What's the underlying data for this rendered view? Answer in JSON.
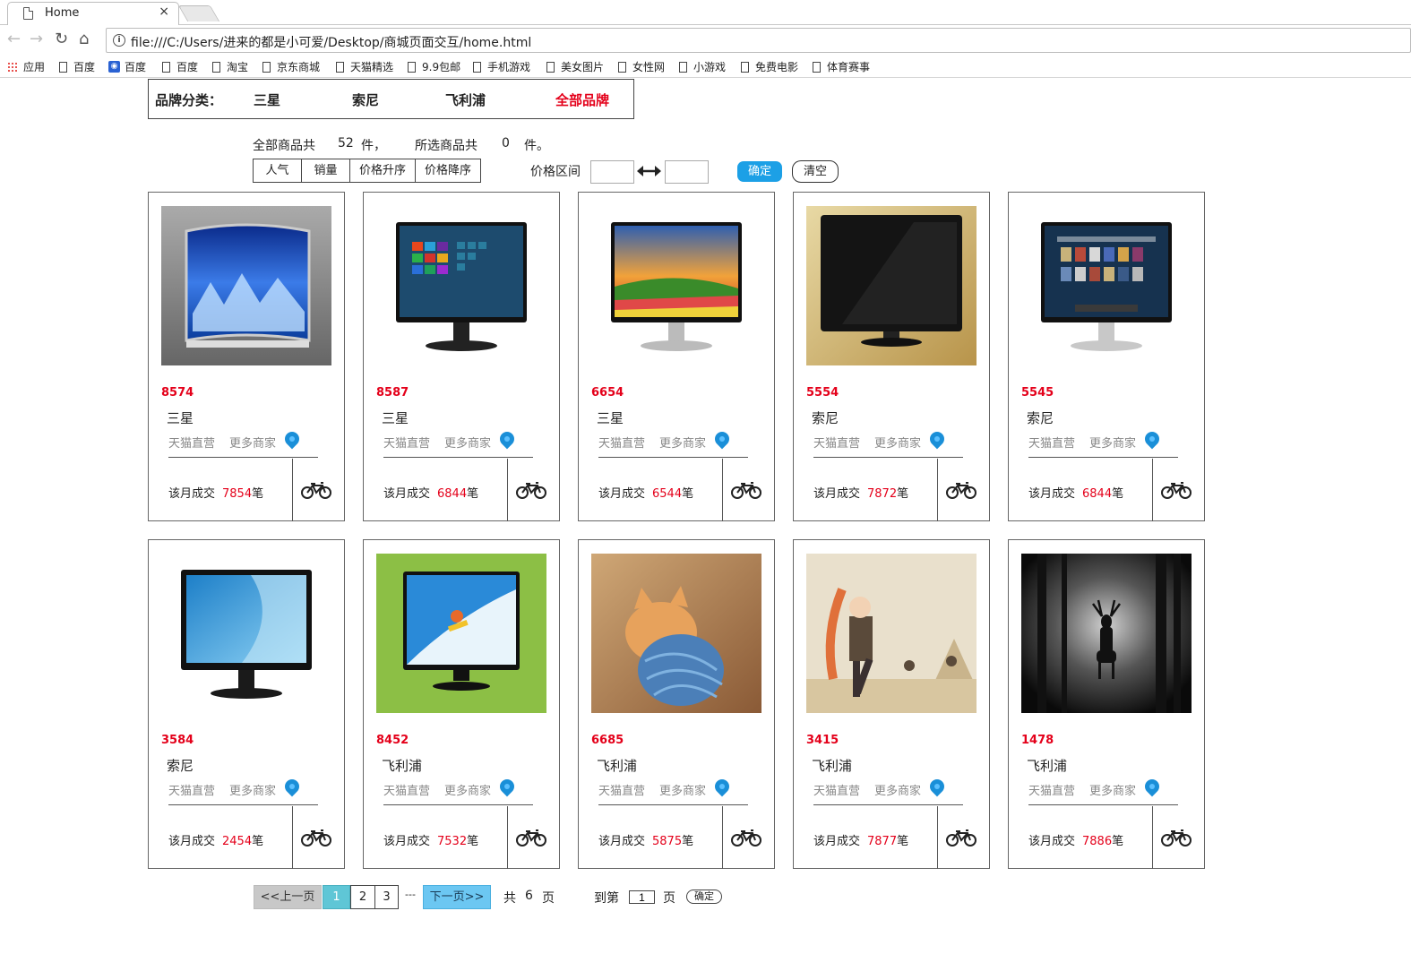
{
  "browser": {
    "tab_title": "Home",
    "tab_close": "×",
    "url": "file:///C:/Users/进来的都是小可爱/Desktop/商城页面交互/home.html",
    "bookmarks": [
      "应用",
      "百度",
      "百度",
      "百度",
      "淘宝",
      "京东商城",
      "天猫精选",
      "9.9包邮",
      "手机游戏",
      "美女图片",
      "女性网",
      "小游戏",
      "免费电影",
      "体育赛事"
    ]
  },
  "brand_filter": {
    "label": "品牌分类：",
    "options": [
      "三星",
      "索尼",
      "飞利浦",
      "全部品牌"
    ],
    "active": "全部品牌"
  },
  "summary": {
    "all_label": "全部商品共",
    "all_count": "52",
    "unit1": "件，",
    "selected_label": "所选商品共",
    "selected_count": "0",
    "unit2": "件。"
  },
  "sort_buttons": [
    "人气",
    "销量",
    "价格升序",
    "价格降序"
  ],
  "price_filter": {
    "label": "价格区间",
    "min": "",
    "max": "",
    "confirm": "确定",
    "clear": "清空"
  },
  "card_labels": {
    "tmall": "天猫直营",
    "more": "更多商家",
    "monthly": "该月成交",
    "unit": "笔"
  },
  "products": [
    {
      "price": "8574",
      "brand": "三星",
      "sales": "7854",
      "image": "curved-monitor"
    },
    {
      "price": "8587",
      "brand": "三星",
      "sales": "6844",
      "image": "windows-monitor"
    },
    {
      "price": "6654",
      "brand": "三星",
      "sales": "6544",
      "image": "landscape-monitor"
    },
    {
      "price": "5554",
      "brand": "索尼",
      "sales": "7872",
      "image": "black-monitor"
    },
    {
      "price": "5545",
      "brand": "索尼",
      "sales": "6844",
      "image": "mac-monitor"
    },
    {
      "price": "3584",
      "brand": "索尼",
      "sales": "2454",
      "image": "blue-monitor"
    },
    {
      "price": "8452",
      "brand": "飞利浦",
      "sales": "7532",
      "image": "surfer-monitor"
    },
    {
      "price": "6685",
      "brand": "飞利浦",
      "sales": "5875",
      "image": "kitten-photo"
    },
    {
      "price": "3415",
      "brand": "飞利浦",
      "sales": "7877",
      "image": "anime-art"
    },
    {
      "price": "1478",
      "brand": "飞利浦",
      "sales": "7886",
      "image": "deer-forest"
    }
  ],
  "pagination": {
    "prev": "<<上一页",
    "pages": [
      "1",
      "2",
      "3"
    ],
    "current": "1",
    "ellipsis": "---",
    "next": "下一页>>",
    "total_prefix": "共",
    "total": "6",
    "total_suffix": "页",
    "goto_prefix": "到第",
    "goto_value": "1",
    "goto_suffix": "页",
    "goto_confirm": "确定"
  },
  "colors": {
    "accent_red": "#e4001a",
    "accent_blue": "#1ca0e6",
    "page_current": "#5fc6d6",
    "next_button": "#6cc7f2"
  }
}
